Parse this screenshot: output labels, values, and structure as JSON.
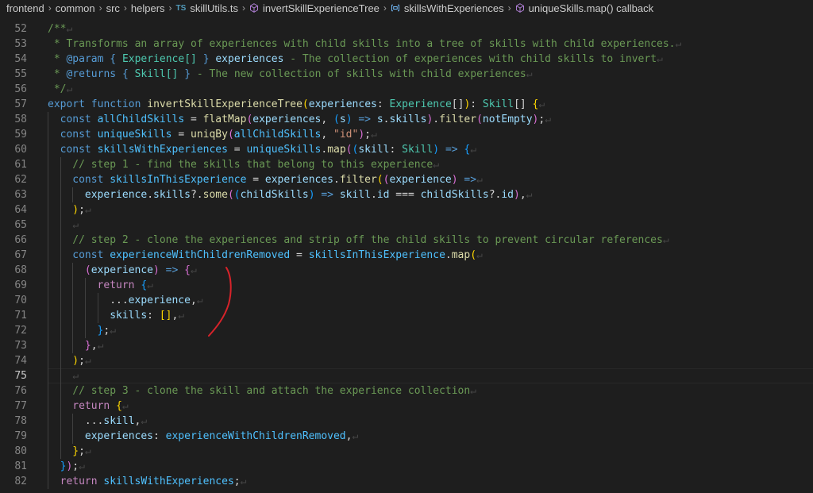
{
  "breadcrumb": [
    {
      "label": "frontend",
      "icon": ""
    },
    {
      "label": "common",
      "icon": ""
    },
    {
      "label": "src",
      "icon": ""
    },
    {
      "label": "helpers",
      "icon": ""
    },
    {
      "label": "skillUtils.ts",
      "icon": "ts-file-icon",
      "badge": "TS"
    },
    {
      "label": "invertSkillExperienceTree",
      "icon": "function-cube-icon"
    },
    {
      "label": "skillsWithExperiences",
      "icon": "variable-field-icon"
    },
    {
      "label": "uniqueSkills.map() callback",
      "icon": "function-cube-icon"
    }
  ],
  "current_line": 75,
  "annotation": "red-pen-stroke",
  "lines": [
    {
      "n": 52,
      "indent": 0,
      "tokens": [
        [
          "t-comment",
          "/**"
        ]
      ]
    },
    {
      "n": 53,
      "indent": 0,
      "tokens": [
        [
          "t-comment",
          " * Transforms an array of experiences with child skills into a tree of skills with child experiences."
        ]
      ]
    },
    {
      "n": 54,
      "indent": 0,
      "tokens": [
        [
          "t-comment",
          " * "
        ],
        [
          "t-doctag",
          "@param"
        ],
        [
          "t-comment",
          " "
        ],
        [
          "t-doctag",
          "{"
        ],
        [
          "t-comment",
          " "
        ],
        [
          "t-type",
          "Experience[]"
        ],
        [
          "t-comment",
          " "
        ],
        [
          "t-doctag",
          "}"
        ],
        [
          "t-comment",
          " "
        ],
        [
          "t-param",
          "experiences"
        ],
        [
          "t-comment",
          " - The collection of experiences with child skills to invert"
        ]
      ]
    },
    {
      "n": 55,
      "indent": 0,
      "tokens": [
        [
          "t-comment",
          " * "
        ],
        [
          "t-doctag",
          "@returns"
        ],
        [
          "t-comment",
          " "
        ],
        [
          "t-doctag",
          "{"
        ],
        [
          "t-comment",
          " "
        ],
        [
          "t-type",
          "Skill[]"
        ],
        [
          "t-comment",
          " "
        ],
        [
          "t-doctag",
          "}"
        ],
        [
          "t-comment",
          " - The new collection of skills with child experiences"
        ]
      ]
    },
    {
      "n": 56,
      "indent": 0,
      "tokens": [
        [
          "t-comment",
          " */"
        ]
      ]
    },
    {
      "n": 57,
      "indent": 0,
      "tokens": [
        [
          "t-kw",
          "export"
        ],
        [
          "t-punc",
          " "
        ],
        [
          "t-kw",
          "function"
        ],
        [
          "t-punc",
          " "
        ],
        [
          "t-fn",
          "invertSkillExperienceTree"
        ],
        [
          "t-b1",
          "("
        ],
        [
          "t-param",
          "experiences"
        ],
        [
          "t-punc",
          ": "
        ],
        [
          "t-type",
          "Experience"
        ],
        [
          "t-punc",
          "[]"
        ],
        [
          "t-b1",
          ")"
        ],
        [
          "t-punc",
          ": "
        ],
        [
          "t-type",
          "Skill"
        ],
        [
          "t-punc",
          "[] "
        ],
        [
          "t-b1",
          "{"
        ]
      ]
    },
    {
      "n": 58,
      "indent": 1,
      "tokens": [
        [
          "t-kw",
          "const"
        ],
        [
          "t-punc",
          " "
        ],
        [
          "t-var",
          "allChildSkills"
        ],
        [
          "t-punc",
          " = "
        ],
        [
          "t-fn",
          "flatMap"
        ],
        [
          "t-b2",
          "("
        ],
        [
          "t-param",
          "experiences"
        ],
        [
          "t-punc",
          ", "
        ],
        [
          "t-b3",
          "("
        ],
        [
          "t-param",
          "s"
        ],
        [
          "t-b3",
          ")"
        ],
        [
          "t-punc",
          " "
        ],
        [
          "t-kw",
          "=>"
        ],
        [
          "t-punc",
          " "
        ],
        [
          "t-param",
          "s"
        ],
        [
          "t-punc",
          "."
        ],
        [
          "t-param",
          "skills"
        ],
        [
          "t-b2",
          ")"
        ],
        [
          "t-punc",
          "."
        ],
        [
          "t-fn",
          "filter"
        ],
        [
          "t-b2",
          "("
        ],
        [
          "t-param",
          "notEmpty"
        ],
        [
          "t-b2",
          ")"
        ],
        [
          "t-punc",
          ";"
        ]
      ]
    },
    {
      "n": 59,
      "indent": 1,
      "tokens": [
        [
          "t-kw",
          "const"
        ],
        [
          "t-punc",
          " "
        ],
        [
          "t-var",
          "uniqueSkills"
        ],
        [
          "t-punc",
          " = "
        ],
        [
          "t-fn",
          "uniqBy"
        ],
        [
          "t-b2",
          "("
        ],
        [
          "t-var",
          "allChildSkills"
        ],
        [
          "t-punc",
          ", "
        ],
        [
          "t-str",
          "\"id\""
        ],
        [
          "t-b2",
          ")"
        ],
        [
          "t-punc",
          ";"
        ]
      ]
    },
    {
      "n": 60,
      "indent": 1,
      "tokens": [
        [
          "t-kw",
          "const"
        ],
        [
          "t-punc",
          " "
        ],
        [
          "t-var",
          "skillsWithExperiences"
        ],
        [
          "t-punc",
          " = "
        ],
        [
          "t-var",
          "uniqueSkills"
        ],
        [
          "t-punc",
          "."
        ],
        [
          "t-fn",
          "map"
        ],
        [
          "t-b2",
          "("
        ],
        [
          "t-b3",
          "("
        ],
        [
          "t-param",
          "skill"
        ],
        [
          "t-punc",
          ": "
        ],
        [
          "t-type",
          "Skill"
        ],
        [
          "t-b3",
          ")"
        ],
        [
          "t-punc",
          " "
        ],
        [
          "t-kw",
          "=>"
        ],
        [
          "t-punc",
          " "
        ],
        [
          "t-b3",
          "{"
        ]
      ]
    },
    {
      "n": 61,
      "indent": 2,
      "tokens": [
        [
          "t-comment",
          "// step 1 - find the skills that belong to this experience"
        ]
      ]
    },
    {
      "n": 62,
      "indent": 2,
      "tokens": [
        [
          "t-kw",
          "const"
        ],
        [
          "t-punc",
          " "
        ],
        [
          "t-var",
          "skillsInThisExperience"
        ],
        [
          "t-punc",
          " = "
        ],
        [
          "t-param",
          "experiences"
        ],
        [
          "t-punc",
          "."
        ],
        [
          "t-fn",
          "filter"
        ],
        [
          "t-b1",
          "("
        ],
        [
          "t-b2",
          "("
        ],
        [
          "t-param",
          "experience"
        ],
        [
          "t-b2",
          ")"
        ],
        [
          "t-punc",
          " "
        ],
        [
          "t-kw",
          "=>"
        ]
      ]
    },
    {
      "n": 63,
      "indent": 3,
      "tokens": [
        [
          "t-param",
          "experience"
        ],
        [
          "t-punc",
          "."
        ],
        [
          "t-param",
          "skills"
        ],
        [
          "t-punc",
          "?."
        ],
        [
          "t-fn",
          "some"
        ],
        [
          "t-b2",
          "("
        ],
        [
          "t-b3",
          "("
        ],
        [
          "t-param",
          "childSkills"
        ],
        [
          "t-b3",
          ")"
        ],
        [
          "t-punc",
          " "
        ],
        [
          "t-kw",
          "=>"
        ],
        [
          "t-punc",
          " "
        ],
        [
          "t-param",
          "skill"
        ],
        [
          "t-punc",
          "."
        ],
        [
          "t-param",
          "id"
        ],
        [
          "t-punc",
          " === "
        ],
        [
          "t-param",
          "childSkills"
        ],
        [
          "t-punc",
          "?."
        ],
        [
          "t-param",
          "id"
        ],
        [
          "t-b2",
          ")"
        ],
        [
          "t-punc",
          ","
        ]
      ]
    },
    {
      "n": 64,
      "indent": 2,
      "tokens": [
        [
          "t-b1",
          ")"
        ],
        [
          "t-punc",
          ";"
        ]
      ]
    },
    {
      "n": 65,
      "indent": 2,
      "tokens": []
    },
    {
      "n": 66,
      "indent": 2,
      "tokens": [
        [
          "t-comment",
          "// step 2 - clone the experiences and strip off the child skills to prevent circular references"
        ]
      ]
    },
    {
      "n": 67,
      "indent": 2,
      "tokens": [
        [
          "t-kw",
          "const"
        ],
        [
          "t-punc",
          " "
        ],
        [
          "t-var",
          "experienceWithChildrenRemoved"
        ],
        [
          "t-punc",
          " = "
        ],
        [
          "t-var",
          "skillsInThisExperience"
        ],
        [
          "t-punc",
          "."
        ],
        [
          "t-fn",
          "map"
        ],
        [
          "t-b1",
          "("
        ]
      ]
    },
    {
      "n": 68,
      "indent": 3,
      "tokens": [
        [
          "t-b2",
          "("
        ],
        [
          "t-param",
          "experience"
        ],
        [
          "t-b2",
          ")"
        ],
        [
          "t-punc",
          " "
        ],
        [
          "t-kw",
          "=>"
        ],
        [
          "t-punc",
          " "
        ],
        [
          "t-b2",
          "{"
        ]
      ]
    },
    {
      "n": 69,
      "indent": 4,
      "tokens": [
        [
          "t-ctrl",
          "return"
        ],
        [
          "t-punc",
          " "
        ],
        [
          "t-b3",
          "{"
        ]
      ]
    },
    {
      "n": 70,
      "indent": 5,
      "tokens": [
        [
          "t-punc",
          "..."
        ],
        [
          "t-param",
          "experience"
        ],
        [
          "t-punc",
          ","
        ]
      ]
    },
    {
      "n": 71,
      "indent": 5,
      "tokens": [
        [
          "t-param",
          "skills"
        ],
        [
          "t-punc",
          ": "
        ],
        [
          "t-b1",
          "[]"
        ],
        [
          "t-punc",
          ","
        ]
      ]
    },
    {
      "n": 72,
      "indent": 4,
      "tokens": [
        [
          "t-b3",
          "}"
        ],
        [
          "t-punc",
          ";"
        ]
      ]
    },
    {
      "n": 73,
      "indent": 3,
      "tokens": [
        [
          "t-b2",
          "}"
        ],
        [
          "t-punc",
          ","
        ]
      ]
    },
    {
      "n": 74,
      "indent": 2,
      "tokens": [
        [
          "t-b1",
          ")"
        ],
        [
          "t-punc",
          ";"
        ]
      ]
    },
    {
      "n": 75,
      "indent": 2,
      "tokens": []
    },
    {
      "n": 76,
      "indent": 2,
      "tokens": [
        [
          "t-comment",
          "// step 3 - clone the skill and attach the experience collection"
        ]
      ]
    },
    {
      "n": 77,
      "indent": 2,
      "tokens": [
        [
          "t-ctrl",
          "return"
        ],
        [
          "t-punc",
          " "
        ],
        [
          "t-b1",
          "{"
        ]
      ]
    },
    {
      "n": 78,
      "indent": 3,
      "tokens": [
        [
          "t-punc",
          "..."
        ],
        [
          "t-param",
          "skill"
        ],
        [
          "t-punc",
          ","
        ]
      ]
    },
    {
      "n": 79,
      "indent": 3,
      "tokens": [
        [
          "t-param",
          "experiences"
        ],
        [
          "t-punc",
          ": "
        ],
        [
          "t-var",
          "experienceWithChildrenRemoved"
        ],
        [
          "t-punc",
          ","
        ]
      ]
    },
    {
      "n": 80,
      "indent": 2,
      "tokens": [
        [
          "t-b1",
          "}"
        ],
        [
          "t-punc",
          ";"
        ]
      ]
    },
    {
      "n": 81,
      "indent": 1,
      "tokens": [
        [
          "t-b3",
          "}"
        ],
        [
          "t-b2",
          ")"
        ],
        [
          "t-punc",
          ";"
        ]
      ]
    },
    {
      "n": 82,
      "indent": 1,
      "tokens": [
        [
          "t-ctrl",
          "return"
        ],
        [
          "t-punc",
          " "
        ],
        [
          "t-var",
          "skillsWithExperiences"
        ],
        [
          "t-punc",
          ";"
        ]
      ]
    }
  ]
}
